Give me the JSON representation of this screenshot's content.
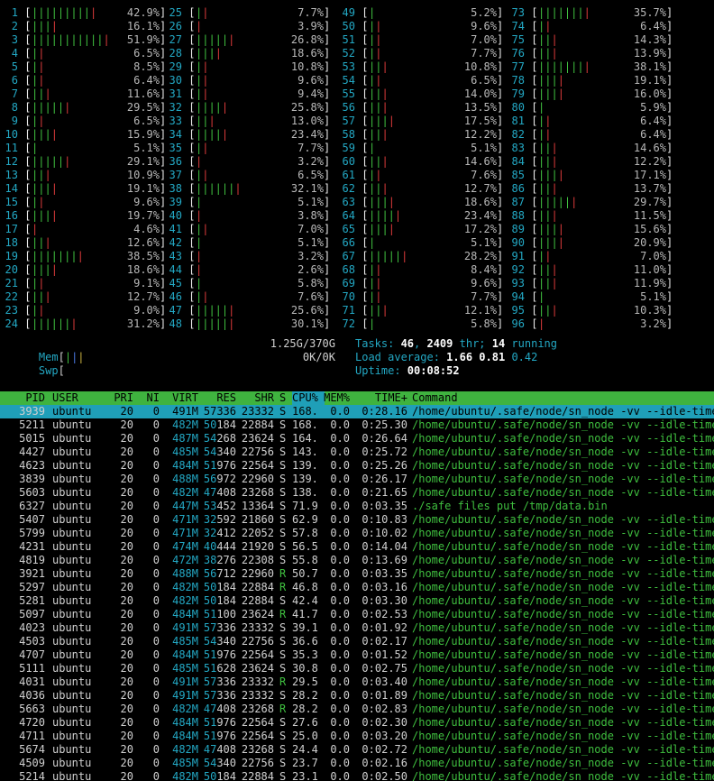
{
  "cpu_meters": [
    {
      "id": "1",
      "g": 9,
      "r": 1,
      "pct": "42.9%"
    },
    {
      "id": "2",
      "g": 3,
      "r": 1,
      "pct": "16.1%"
    },
    {
      "id": "3",
      "g": 11,
      "r": 1,
      "pct": "51.9%"
    },
    {
      "id": "4",
      "g": 1,
      "r": 1,
      "pct": "6.5%"
    },
    {
      "id": "5",
      "g": 1,
      "r": 1,
      "pct": "8.5%"
    },
    {
      "id": "6",
      "g": 1,
      "r": 1,
      "pct": "6.4%"
    },
    {
      "id": "7",
      "g": 2,
      "r": 1,
      "pct": "11.6%"
    },
    {
      "id": "8",
      "g": 5,
      "r": 1,
      "pct": "29.5%"
    },
    {
      "id": "9",
      "g": 1,
      "r": 1,
      "pct": "6.5%"
    },
    {
      "id": "10",
      "g": 3,
      "r": 1,
      "pct": "15.9%"
    },
    {
      "id": "11",
      "g": 1,
      "r": 0,
      "pct": "5.1%"
    },
    {
      "id": "12",
      "g": 5,
      "r": 1,
      "pct": "29.1%"
    },
    {
      "id": "13",
      "g": 2,
      "r": 1,
      "pct": "10.9%"
    },
    {
      "id": "14",
      "g": 3,
      "r": 1,
      "pct": "19.1%"
    },
    {
      "id": "15",
      "g": 1,
      "r": 1,
      "pct": "9.6%"
    },
    {
      "id": "16",
      "g": 3,
      "r": 1,
      "pct": "19.7%"
    },
    {
      "id": "17",
      "g": 0,
      "r": 1,
      "pct": "4.6%"
    },
    {
      "id": "18",
      "g": 2,
      "r": 1,
      "pct": "12.6%"
    },
    {
      "id": "19",
      "g": 7,
      "r": 1,
      "pct": "38.5%"
    },
    {
      "id": "20",
      "g": 3,
      "r": 1,
      "pct": "18.6%"
    },
    {
      "id": "21",
      "g": 1,
      "r": 1,
      "pct": "9.1%"
    },
    {
      "id": "22",
      "g": 2,
      "r": 1,
      "pct": "12.7%"
    },
    {
      "id": "23",
      "g": 1,
      "r": 1,
      "pct": "9.0%"
    },
    {
      "id": "24",
      "g": 6,
      "r": 1,
      "pct": "31.2%"
    },
    {
      "id": "25",
      "g": 1,
      "r": 1,
      "pct": "7.7%"
    },
    {
      "id": "26",
      "g": 0,
      "r": 1,
      "pct": "3.9%"
    },
    {
      "id": "27",
      "g": 5,
      "r": 1,
      "pct": "26.8%"
    },
    {
      "id": "28",
      "g": 3,
      "r": 1,
      "pct": "18.6%"
    },
    {
      "id": "29",
      "g": 1,
      "r": 1,
      "pct": "10.8%"
    },
    {
      "id": "30",
      "g": 1,
      "r": 1,
      "pct": "9.6%"
    },
    {
      "id": "31",
      "g": 1,
      "r": 1,
      "pct": "9.4%"
    },
    {
      "id": "32",
      "g": 4,
      "r": 1,
      "pct": "25.8%"
    },
    {
      "id": "33",
      "g": 2,
      "r": 1,
      "pct": "13.0%"
    },
    {
      "id": "34",
      "g": 4,
      "r": 1,
      "pct": "23.4%"
    },
    {
      "id": "35",
      "g": 1,
      "r": 1,
      "pct": "7.7%"
    },
    {
      "id": "36",
      "g": 0,
      "r": 1,
      "pct": "3.2%"
    },
    {
      "id": "37",
      "g": 1,
      "r": 1,
      "pct": "6.5%"
    },
    {
      "id": "38",
      "g": 6,
      "r": 1,
      "pct": "32.1%"
    },
    {
      "id": "39",
      "g": 1,
      "r": 0,
      "pct": "5.1%"
    },
    {
      "id": "40",
      "g": 0,
      "r": 1,
      "pct": "3.8%"
    },
    {
      "id": "41",
      "g": 1,
      "r": 1,
      "pct": "7.0%"
    },
    {
      "id": "42",
      "g": 1,
      "r": 0,
      "pct": "5.1%"
    },
    {
      "id": "43",
      "g": 0,
      "r": 1,
      "pct": "3.2%"
    },
    {
      "id": "44",
      "g": 0,
      "r": 1,
      "pct": "2.6%"
    },
    {
      "id": "45",
      "g": 1,
      "r": 0,
      "pct": "5.8%"
    },
    {
      "id": "46",
      "g": 1,
      "r": 1,
      "pct": "7.6%"
    },
    {
      "id": "47",
      "g": 5,
      "r": 1,
      "pct": "25.6%"
    },
    {
      "id": "48",
      "g": 5,
      "r": 1,
      "pct": "30.1%"
    },
    {
      "id": "49",
      "g": 1,
      "r": 0,
      "pct": "5.2%"
    },
    {
      "id": "50",
      "g": 1,
      "r": 1,
      "pct": "9.6%"
    },
    {
      "id": "51",
      "g": 1,
      "r": 1,
      "pct": "7.0%"
    },
    {
      "id": "52",
      "g": 1,
      "r": 1,
      "pct": "7.7%"
    },
    {
      "id": "53",
      "g": 2,
      "r": 1,
      "pct": "10.8%"
    },
    {
      "id": "54",
      "g": 1,
      "r": 1,
      "pct": "6.5%"
    },
    {
      "id": "55",
      "g": 2,
      "r": 1,
      "pct": "14.0%"
    },
    {
      "id": "56",
      "g": 2,
      "r": 1,
      "pct": "13.5%"
    },
    {
      "id": "57",
      "g": 3,
      "r": 1,
      "pct": "17.5%"
    },
    {
      "id": "58",
      "g": 2,
      "r": 1,
      "pct": "12.2%"
    },
    {
      "id": "59",
      "g": 1,
      "r": 0,
      "pct": "5.1%"
    },
    {
      "id": "60",
      "g": 2,
      "r": 1,
      "pct": "14.6%"
    },
    {
      "id": "61",
      "g": 1,
      "r": 1,
      "pct": "7.6%"
    },
    {
      "id": "62",
      "g": 2,
      "r": 1,
      "pct": "12.7%"
    },
    {
      "id": "63",
      "g": 3,
      "r": 1,
      "pct": "18.6%"
    },
    {
      "id": "64",
      "g": 4,
      "r": 1,
      "pct": "23.4%"
    },
    {
      "id": "65",
      "g": 3,
      "r": 1,
      "pct": "17.2%"
    },
    {
      "id": "66",
      "g": 1,
      "r": 0,
      "pct": "5.1%"
    },
    {
      "id": "67",
      "g": 5,
      "r": 1,
      "pct": "28.2%"
    },
    {
      "id": "68",
      "g": 1,
      "r": 1,
      "pct": "8.4%"
    },
    {
      "id": "69",
      "g": 1,
      "r": 1,
      "pct": "9.6%"
    },
    {
      "id": "70",
      "g": 1,
      "r": 1,
      "pct": "7.7%"
    },
    {
      "id": "71",
      "g": 2,
      "r": 1,
      "pct": "12.1%"
    },
    {
      "id": "72",
      "g": 1,
      "r": 0,
      "pct": "5.8%"
    },
    {
      "id": "73",
      "g": 7,
      "r": 1,
      "pct": "35.7%"
    },
    {
      "id": "74",
      "g": 1,
      "r": 1,
      "pct": "6.4%"
    },
    {
      "id": "75",
      "g": 2,
      "r": 1,
      "pct": "14.3%"
    },
    {
      "id": "76",
      "g": 2,
      "r": 1,
      "pct": "13.9%"
    },
    {
      "id": "77",
      "g": 7,
      "r": 1,
      "pct": "38.1%"
    },
    {
      "id": "78",
      "g": 3,
      "r": 1,
      "pct": "19.1%"
    },
    {
      "id": "79",
      "g": 3,
      "r": 1,
      "pct": "16.0%"
    },
    {
      "id": "80",
      "g": 1,
      "r": 0,
      "pct": "5.9%"
    },
    {
      "id": "81",
      "g": 1,
      "r": 1,
      "pct": "6.4%"
    },
    {
      "id": "82",
      "g": 1,
      "r": 1,
      "pct": "6.4%"
    },
    {
      "id": "83",
      "g": 2,
      "r": 1,
      "pct": "14.6%"
    },
    {
      "id": "84",
      "g": 2,
      "r": 1,
      "pct": "12.2%"
    },
    {
      "id": "85",
      "g": 3,
      "r": 1,
      "pct": "17.1%"
    },
    {
      "id": "86",
      "g": 2,
      "r": 1,
      "pct": "13.7%"
    },
    {
      "id": "87",
      "g": 5,
      "r": 1,
      "pct": "29.7%"
    },
    {
      "id": "88",
      "g": 2,
      "r": 1,
      "pct": "11.5%"
    },
    {
      "id": "89",
      "g": 3,
      "r": 1,
      "pct": "15.6%"
    },
    {
      "id": "90",
      "g": 3,
      "r": 1,
      "pct": "20.9%"
    },
    {
      "id": "91",
      "g": 1,
      "r": 1,
      "pct": "7.0%"
    },
    {
      "id": "92",
      "g": 2,
      "r": 1,
      "pct": "11.0%"
    },
    {
      "id": "93",
      "g": 2,
      "r": 1,
      "pct": "11.9%"
    },
    {
      "id": "94",
      "g": 1,
      "r": 0,
      "pct": "5.1%"
    },
    {
      "id": "95",
      "g": 2,
      "r": 1,
      "pct": "10.3%"
    },
    {
      "id": "96",
      "g": 0,
      "r": 1,
      "pct": "3.2%"
    }
  ],
  "mem": {
    "label": "Mem",
    "value": "1.25G/370G"
  },
  "swp": {
    "label": "Swp",
    "value": "0K/0K"
  },
  "tasks": {
    "label": "Tasks: ",
    "tasks": "46",
    "sep1": ", ",
    "thr": "2409",
    "thr_label": " thr; ",
    "running": "14",
    "running_label": " running"
  },
  "load": {
    "label": "Load average: ",
    "l1": "1.66",
    "l5": "0.81",
    "l15": "0.42"
  },
  "uptime": {
    "label": "Uptime: ",
    "value": "00:08:52"
  },
  "columns": [
    "PID",
    "USER",
    "PRI",
    "NI",
    "VIRT",
    "RES",
    "SHR",
    "S",
    "CPU%",
    "MEM%",
    "TIME+",
    "Command"
  ],
  "processes": [
    {
      "pid": "3939",
      "user": "ubuntu",
      "pri": "20",
      "ni": "0",
      "virt": "491M",
      "res": "57336",
      "shr": "23332",
      "s": "S",
      "cpu": "168.",
      "mem": "0.0",
      "time": "0:28.16",
      "cmd": "/home/ubuntu/.safe/node/sn_node -vv --idle-timeo"
    },
    {
      "pid": "5211",
      "user": "ubuntu",
      "pri": "20",
      "ni": "0",
      "virt": "482M",
      "res": "50184",
      "shr": "22884",
      "s": "S",
      "cpu": "168.",
      "mem": "0.0",
      "time": "0:25.30",
      "cmd": "/home/ubuntu/.safe/node/sn_node -vv --idle-timeo"
    },
    {
      "pid": "5015",
      "user": "ubuntu",
      "pri": "20",
      "ni": "0",
      "virt": "487M",
      "res": "54268",
      "shr": "23624",
      "s": "S",
      "cpu": "164.",
      "mem": "0.0",
      "time": "0:26.64",
      "cmd": "/home/ubuntu/.safe/node/sn_node -vv --idle-timeo"
    },
    {
      "pid": "4427",
      "user": "ubuntu",
      "pri": "20",
      "ni": "0",
      "virt": "485M",
      "res": "54340",
      "shr": "22756",
      "s": "S",
      "cpu": "143.",
      "mem": "0.0",
      "time": "0:25.72",
      "cmd": "/home/ubuntu/.safe/node/sn_node -vv --idle-timeo"
    },
    {
      "pid": "4623",
      "user": "ubuntu",
      "pri": "20",
      "ni": "0",
      "virt": "484M",
      "res": "51976",
      "shr": "22564",
      "s": "S",
      "cpu": "139.",
      "mem": "0.0",
      "time": "0:25.26",
      "cmd": "/home/ubuntu/.safe/node/sn_node -vv --idle-timeo"
    },
    {
      "pid": "3839",
      "user": "ubuntu",
      "pri": "20",
      "ni": "0",
      "virt": "488M",
      "res": "56972",
      "shr": "22960",
      "s": "S",
      "cpu": "139.",
      "mem": "0.0",
      "time": "0:26.17",
      "cmd": "/home/ubuntu/.safe/node/sn_node -vv --idle-timeo"
    },
    {
      "pid": "5603",
      "user": "ubuntu",
      "pri": "20",
      "ni": "0",
      "virt": "482M",
      "res": "47408",
      "shr": "23268",
      "s": "S",
      "cpu": "138.",
      "mem": "0.0",
      "time": "0:21.65",
      "cmd": "/home/ubuntu/.safe/node/sn_node -vv --idle-timeo"
    },
    {
      "pid": "6327",
      "user": "ubuntu",
      "pri": "20",
      "ni": "0",
      "virt": "447M",
      "res": "53452",
      "shr": "13364",
      "s": "S",
      "cpu": "71.9",
      "mem": "0.0",
      "time": "0:03.35",
      "cmd": "./safe files put /tmp/data.bin"
    },
    {
      "pid": "5407",
      "user": "ubuntu",
      "pri": "20",
      "ni": "0",
      "virt": "471M",
      "res": "32592",
      "shr": "21860",
      "s": "S",
      "cpu": "62.9",
      "mem": "0.0",
      "time": "0:10.83",
      "cmd": "/home/ubuntu/.safe/node/sn_node -vv --idle-timeo"
    },
    {
      "pid": "5799",
      "user": "ubuntu",
      "pri": "20",
      "ni": "0",
      "virt": "471M",
      "res": "32412",
      "shr": "22052",
      "s": "S",
      "cpu": "57.8",
      "mem": "0.0",
      "time": "0:10.02",
      "cmd": "/home/ubuntu/.safe/node/sn_node -vv --idle-timeo"
    },
    {
      "pid": "4231",
      "user": "ubuntu",
      "pri": "20",
      "ni": "0",
      "virt": "474M",
      "res": "40444",
      "shr": "21920",
      "s": "S",
      "cpu": "56.5",
      "mem": "0.0",
      "time": "0:14.04",
      "cmd": "/home/ubuntu/.safe/node/sn_node -vv --idle-timeo"
    },
    {
      "pid": "4819",
      "user": "ubuntu",
      "pri": "20",
      "ni": "0",
      "virt": "472M",
      "res": "38276",
      "shr": "22308",
      "s": "S",
      "cpu": "55.8",
      "mem": "0.0",
      "time": "0:13.69",
      "cmd": "/home/ubuntu/.safe/node/sn_node -vv --idle-timeo"
    },
    {
      "pid": "3921",
      "user": "ubuntu",
      "pri": "20",
      "ni": "0",
      "virt": "488M",
      "res": "56712",
      "shr": "22960",
      "s": "R",
      "cpu": "50.7",
      "mem": "0.0",
      "time": "0:03.35",
      "cmd": "/home/ubuntu/.safe/node/sn_node -vv --idle-timeo"
    },
    {
      "pid": "5297",
      "user": "ubuntu",
      "pri": "20",
      "ni": "0",
      "virt": "482M",
      "res": "50184",
      "shr": "22884",
      "s": "R",
      "cpu": "46.8",
      "mem": "0.0",
      "time": "0:03.16",
      "cmd": "/home/ubuntu/.safe/node/sn_node -vv --idle-timeo"
    },
    {
      "pid": "5281",
      "user": "ubuntu",
      "pri": "20",
      "ni": "0",
      "virt": "482M",
      "res": "50184",
      "shr": "22884",
      "s": "S",
      "cpu": "42.4",
      "mem": "0.0",
      "time": "0:03.30",
      "cmd": "/home/ubuntu/.safe/node/sn_node -vv --idle-timeo"
    },
    {
      "pid": "5097",
      "user": "ubuntu",
      "pri": "20",
      "ni": "0",
      "virt": "484M",
      "res": "51100",
      "shr": "23624",
      "s": "R",
      "cpu": "41.7",
      "mem": "0.0",
      "time": "0:02.53",
      "cmd": "/home/ubuntu/.safe/node/sn_node -vv --idle-timeo"
    },
    {
      "pid": "4023",
      "user": "ubuntu",
      "pri": "20",
      "ni": "0",
      "virt": "491M",
      "res": "57336",
      "shr": "23332",
      "s": "S",
      "cpu": "39.1",
      "mem": "0.0",
      "time": "0:01.92",
      "cmd": "/home/ubuntu/.safe/node/sn_node -vv --idle-timeo"
    },
    {
      "pid": "4503",
      "user": "ubuntu",
      "pri": "20",
      "ni": "0",
      "virt": "485M",
      "res": "54340",
      "shr": "22756",
      "s": "S",
      "cpu": "36.6",
      "mem": "0.0",
      "time": "0:02.17",
      "cmd": "/home/ubuntu/.safe/node/sn_node -vv --idle-timeo"
    },
    {
      "pid": "4707",
      "user": "ubuntu",
      "pri": "20",
      "ni": "0",
      "virt": "484M",
      "res": "51976",
      "shr": "22564",
      "s": "S",
      "cpu": "35.3",
      "mem": "0.0",
      "time": "0:01.52",
      "cmd": "/home/ubuntu/.safe/node/sn_node -vv --idle-timeo"
    },
    {
      "pid": "5111",
      "user": "ubuntu",
      "pri": "20",
      "ni": "0",
      "virt": "485M",
      "res": "51628",
      "shr": "23624",
      "s": "S",
      "cpu": "30.8",
      "mem": "0.0",
      "time": "0:02.75",
      "cmd": "/home/ubuntu/.safe/node/sn_node -vv --idle-timeo"
    },
    {
      "pid": "4031",
      "user": "ubuntu",
      "pri": "20",
      "ni": "0",
      "virt": "491M",
      "res": "57336",
      "shr": "23332",
      "s": "R",
      "cpu": "29.5",
      "mem": "0.0",
      "time": "0:03.40",
      "cmd": "/home/ubuntu/.safe/node/sn_node -vv --idle-timeo"
    },
    {
      "pid": "4036",
      "user": "ubuntu",
      "pri": "20",
      "ni": "0",
      "virt": "491M",
      "res": "57336",
      "shr": "23332",
      "s": "S",
      "cpu": "28.2",
      "mem": "0.0",
      "time": "0:01.89",
      "cmd": "/home/ubuntu/.safe/node/sn_node -vv --idle-timeo"
    },
    {
      "pid": "5663",
      "user": "ubuntu",
      "pri": "20",
      "ni": "0",
      "virt": "482M",
      "res": "47408",
      "shr": "23268",
      "s": "R",
      "cpu": "28.2",
      "mem": "0.0",
      "time": "0:02.83",
      "cmd": "/home/ubuntu/.safe/node/sn_node -vv --idle-timeo"
    },
    {
      "pid": "4720",
      "user": "ubuntu",
      "pri": "20",
      "ni": "0",
      "virt": "484M",
      "res": "51976",
      "shr": "22564",
      "s": "S",
      "cpu": "27.6",
      "mem": "0.0",
      "time": "0:02.30",
      "cmd": "/home/ubuntu/.safe/node/sn_node -vv --idle-timeo"
    },
    {
      "pid": "4711",
      "user": "ubuntu",
      "pri": "20",
      "ni": "0",
      "virt": "484M",
      "res": "51976",
      "shr": "22564",
      "s": "S",
      "cpu": "25.0",
      "mem": "0.0",
      "time": "0:03.20",
      "cmd": "/home/ubuntu/.safe/node/sn_node -vv --idle-timeo"
    },
    {
      "pid": "5674",
      "user": "ubuntu",
      "pri": "20",
      "ni": "0",
      "virt": "482M",
      "res": "47408",
      "shr": "23268",
      "s": "S",
      "cpu": "24.4",
      "mem": "0.0",
      "time": "0:02.72",
      "cmd": "/home/ubuntu/.safe/node/sn_node -vv --idle-timeo"
    },
    {
      "pid": "4509",
      "user": "ubuntu",
      "pri": "20",
      "ni": "0",
      "virt": "485M",
      "res": "54340",
      "shr": "22756",
      "s": "S",
      "cpu": "23.7",
      "mem": "0.0",
      "time": "0:02.16",
      "cmd": "/home/ubuntu/.safe/node/sn_node -vv --idle-timeo"
    },
    {
      "pid": "5214",
      "user": "ubuntu",
      "pri": "20",
      "ni": "0",
      "virt": "482M",
      "res": "50184",
      "shr": "22884",
      "s": "S",
      "cpu": "23.1",
      "mem": "0.0",
      "time": "0:02.50",
      "cmd": "/home/ubuntu/.safe/node/sn_node -vv --idle-timeo"
    }
  ],
  "colors": {
    "green": "#3fbf3f",
    "red": "#d83a3a",
    "cyan": "#23a8c4",
    "header_bg": "#3fb33f",
    "selected_bg": "#1f9fb8"
  }
}
